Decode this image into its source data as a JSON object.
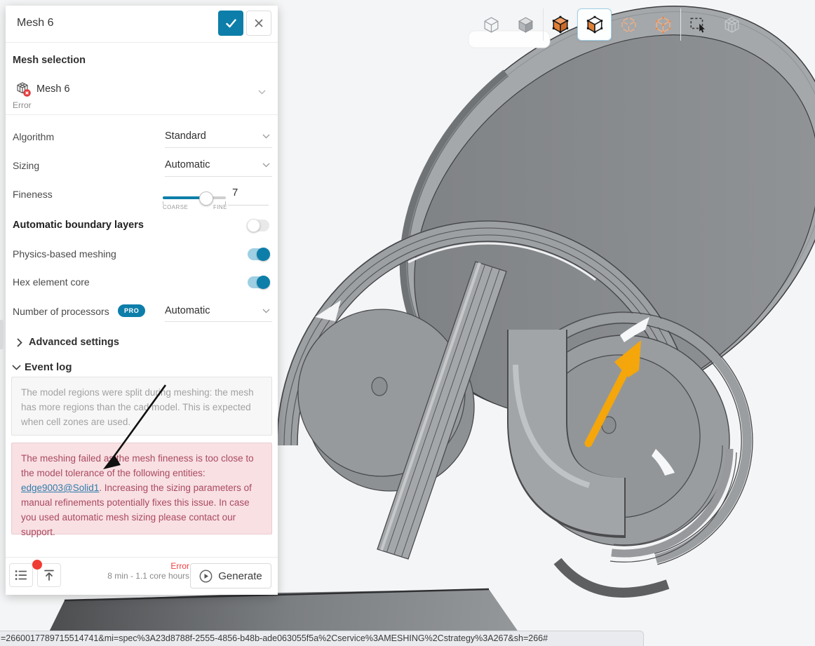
{
  "panel": {
    "title": "Mesh 6",
    "confirm_tooltip": "confirm",
    "mesh_selection": {
      "heading": "Mesh selection",
      "item_label": "Mesh 6",
      "item_status": "Error"
    },
    "fields": [
      {
        "label": "Algorithm",
        "value": "Standard"
      },
      {
        "label": "Sizing",
        "value": "Automatic"
      }
    ],
    "fineness": {
      "label": "Fineness",
      "value": "7",
      "min_label": "COARSE",
      "max_label": "FINE",
      "percent": 68
    },
    "toggles": [
      {
        "label": "Automatic boundary layers",
        "on": false
      },
      {
        "label": "Physics-based meshing",
        "on": true
      },
      {
        "label": "Hex element core",
        "on": true
      }
    ],
    "processors": {
      "label": "Number of processors",
      "badge": "PRO",
      "value": "Automatic"
    },
    "advanced": {
      "label": "Advanced settings"
    },
    "event_log": {
      "label": "Event log",
      "info_message": "The model regions were split during meshing: the mesh has more regions than the cad model. This is expected when cell zones are used.",
      "error_message_pre": "The meshing failed as the mesh fineness is too close to the model tolerance of the following entities: ",
      "error_link": "edge9003@Solid1",
      "error_message_post": ". Increasing the sizing parameters of manual refinements potentially fixes this issue. In case you used automatic mesh sizing please contact our support."
    },
    "footer": {
      "status": "Error",
      "estimate": "8 min - 1.1 core hours",
      "generate_label": "Generate"
    }
  },
  "toolbar": {
    "selected_index": 3,
    "icons": [
      "wireframe-cube",
      "shaded-cube",
      "solid-orange-cube",
      "face-select-cube",
      "vertex-select-cube",
      "edge-select-cube",
      "box-select",
      "mesh-cube-disabled"
    ]
  },
  "statusbar": {
    "url": "=2660017789715514741&mi=spec%3A23d8788f-2555-4856-b48b-ade063055f5a%2Cservice%3AMESHING%2Cstrategy%3A267&sh=266#"
  },
  "colors": {
    "accent_blue": "#0d7ea9",
    "error_red": "#f23d3d",
    "error_box_bg": "#f8e0e3",
    "error_box_text": "#ab4a60",
    "link_blue": "#2f7cab",
    "annotation_orange": "#f4a60b",
    "viewport_bg": "#f4f5f6"
  }
}
